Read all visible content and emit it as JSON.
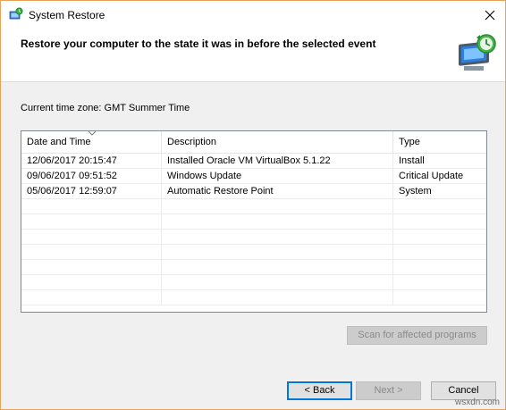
{
  "window": {
    "title": "System Restore"
  },
  "header": {
    "heading": "Restore your computer to the state it was in before the selected event"
  },
  "timezone_text": "Current time zone: GMT Summer Time",
  "restore_points": {
    "columns": [
      "Date and Time",
      "Description",
      "Type"
    ],
    "rows": [
      [
        "12/06/2017 20:15:47",
        "Installed Oracle VM VirtualBox 5.1.22",
        "Install"
      ],
      [
        "09/06/2017 09:51:52",
        "Windows Update",
        "Critical Update"
      ],
      [
        "05/06/2017 12:59:07",
        "Automatic Restore Point",
        "System"
      ]
    ]
  },
  "buttons": {
    "scan": "Scan for affected programs",
    "back": "< Back",
    "next": "Next >",
    "cancel": "Cancel"
  },
  "watermark": "wsxdn.com",
  "colors": {
    "accent_border": "#e8a25a",
    "focus": "#0078d7"
  }
}
